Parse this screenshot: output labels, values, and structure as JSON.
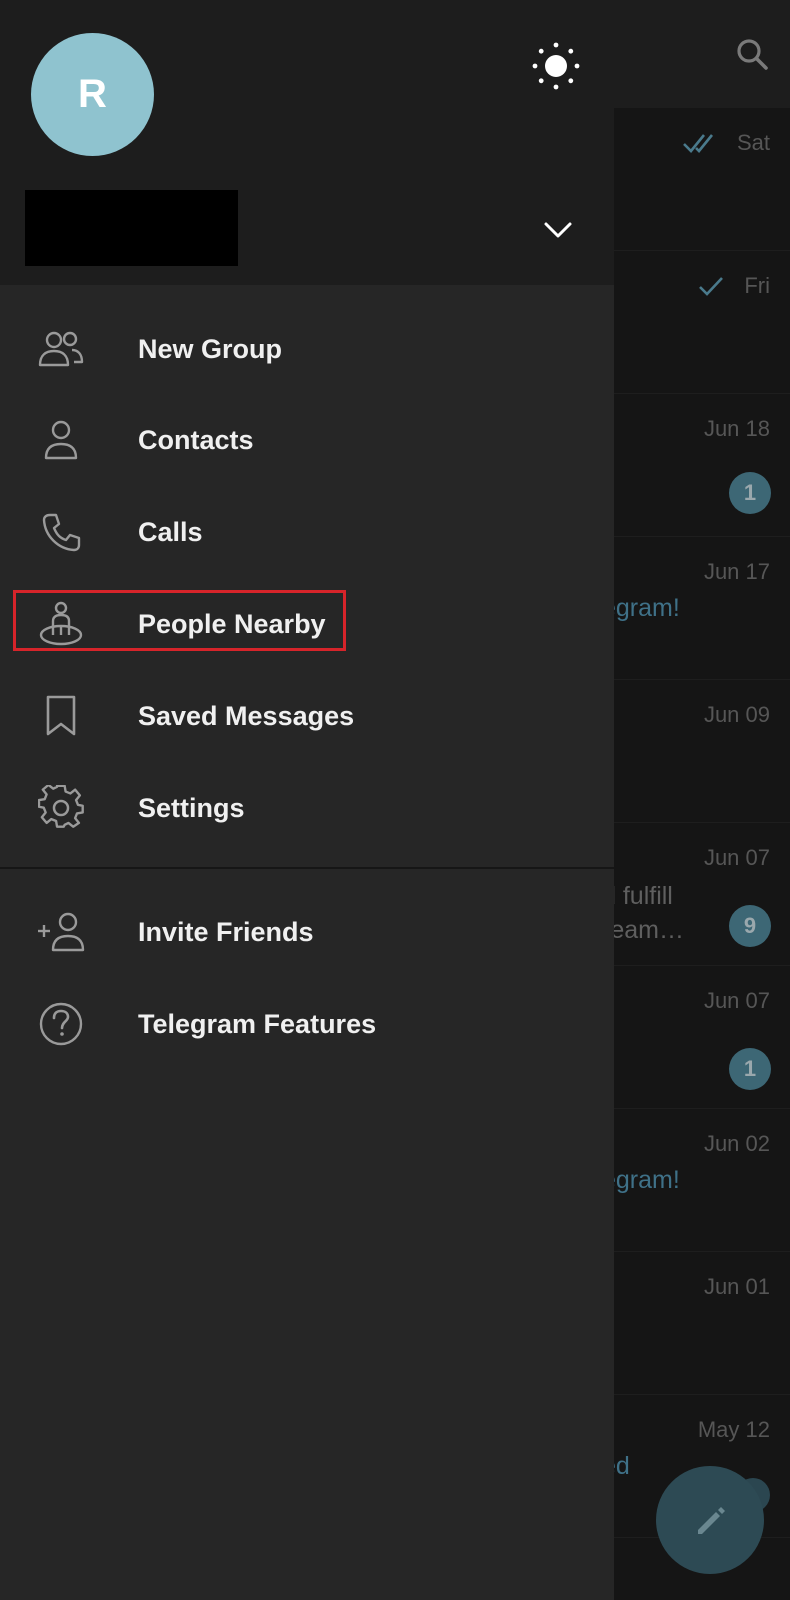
{
  "drawer": {
    "avatar_initial": "R",
    "account_name": "",
    "menu_items": [
      {
        "id": "new-group",
        "label": "New Group",
        "icon": "group-icon"
      },
      {
        "id": "contacts",
        "label": "Contacts",
        "icon": "person-icon"
      },
      {
        "id": "calls",
        "label": "Calls",
        "icon": "phone-icon"
      },
      {
        "id": "people-nearby",
        "label": "People Nearby",
        "icon": "people-nearby-icon"
      },
      {
        "id": "saved-messages",
        "label": "Saved Messages",
        "icon": "bookmark-icon"
      },
      {
        "id": "settings",
        "label": "Settings",
        "icon": "gear-icon"
      }
    ],
    "extra_items": [
      {
        "id": "invite-friends",
        "label": "Invite Friends",
        "icon": "add-person-icon"
      },
      {
        "id": "telegram-features",
        "label": "Telegram Features",
        "icon": "help-icon"
      }
    ]
  },
  "chat_list": {
    "rows": [
      {
        "date": "Sat",
        "status": "double-check-icon"
      },
      {
        "date": "Fri",
        "status": "check-icon"
      },
      {
        "date": "Jun 18",
        "badge": "1"
      },
      {
        "date": "Jun 17",
        "preview": "egram!"
      },
      {
        "date": "Jun 09"
      },
      {
        "date": "Jun 07",
        "preview_line1": "d fulfill",
        "preview_line2": "ream…",
        "badge": "9"
      },
      {
        "date": "Jun 07",
        "badge": "1"
      },
      {
        "date": "Jun 02",
        "preview": "egram!"
      },
      {
        "date": "Jun 01"
      },
      {
        "date": "May 12",
        "preview": "ed"
      }
    ]
  },
  "colors": {
    "accent": "#8fc3cf",
    "highlight": "#d6242a",
    "drawer_bg": "#262626",
    "header_bg": "#1d1d1d"
  }
}
